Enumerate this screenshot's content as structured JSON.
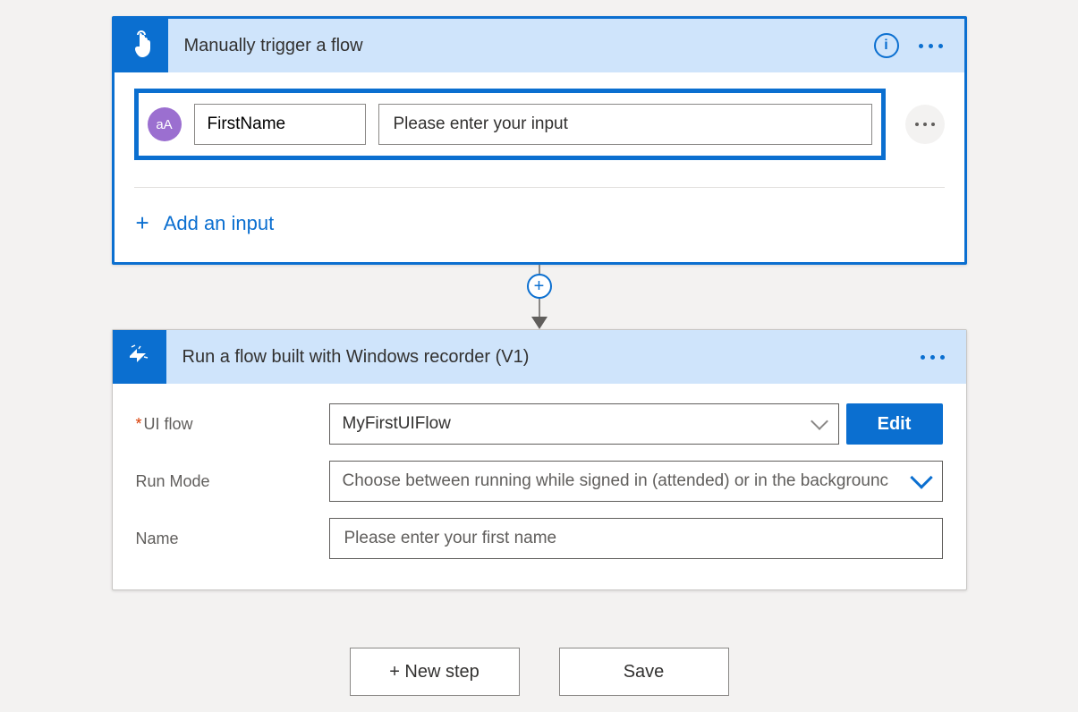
{
  "trigger": {
    "title": "Manually trigger a flow",
    "input_type_icon": "aA",
    "input_name": "FirstName",
    "input_desc": "Please enter your input",
    "add_input_label": "Add an input"
  },
  "action": {
    "title": "Run a flow built with Windows recorder (V1)",
    "fields": {
      "uiflow_label": "UI flow",
      "uiflow_value": "MyFirstUIFlow",
      "edit_label": "Edit",
      "runmode_label": "Run Mode",
      "runmode_placeholder": "Choose between running while signed in (attended) or in the backgrounc",
      "name_label": "Name",
      "name_placeholder": "Please enter your first name"
    }
  },
  "footer": {
    "new_step": "+ New step",
    "save": "Save"
  }
}
